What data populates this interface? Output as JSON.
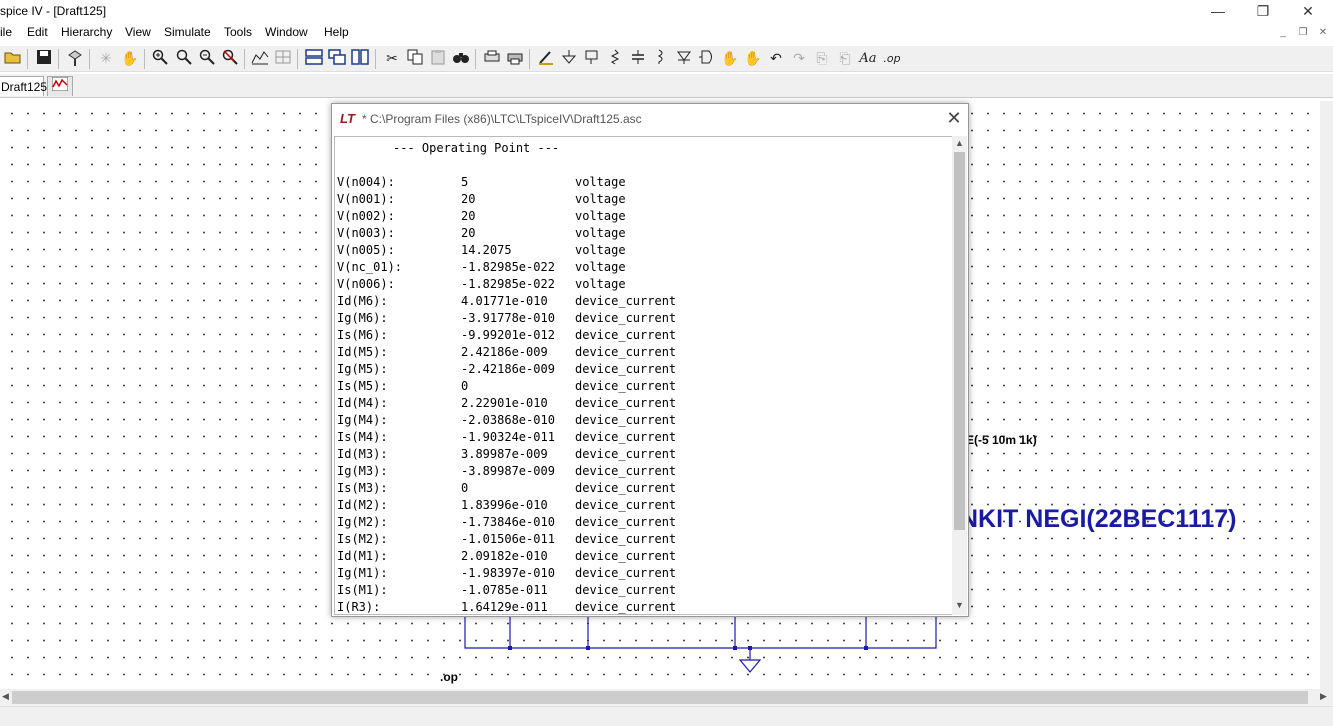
{
  "window": {
    "title": "spice IV - [Draft125]",
    "minimize": "—",
    "restore": "❐",
    "close": "✕"
  },
  "menu": {
    "items": [
      "ile",
      "Edit",
      "Hierarchy",
      "View",
      "Simulate",
      "Tools",
      "Window",
      "Help"
    ],
    "mdi_min": "_",
    "mdi_restore": "❐",
    "mdi_close": "✕"
  },
  "toolbar": {
    "icons": [
      "open-folder-icon",
      "save-icon",
      "control-panel-icon",
      "run-icon",
      "pan-hand-icon",
      "zoom-in-icon",
      "zoom-out-icon",
      "zoom-fit-icon",
      "zoom-cancel-icon",
      "autorange-icon",
      "grid-icon",
      "tile-horizontal-icon",
      "cascade-icon",
      "tile-vertical-icon",
      "cut-icon",
      "copy-icon",
      "paste-icon",
      "find-icon",
      "print-preview-icon",
      "print-icon",
      "wire-icon",
      "ground-icon",
      "label-net-icon",
      "resistor-icon",
      "capacitor-icon",
      "inductor-icon",
      "diode-icon",
      "component-icon",
      "move-icon",
      "drag-icon",
      "undo-icon",
      "redo-icon",
      "rotate-icon",
      "mirror-icon",
      "text-icon",
      "spice-directive-icon"
    ],
    "text_label": "Aa",
    "op_label": ".op"
  },
  "tabs": {
    "schematic": "Draft125"
  },
  "schematic": {
    "source_label": "E(-5 10m 1k)",
    "name_label": "NKIT NEGI(22BEC1117)",
    "directive": ".op"
  },
  "dialog": {
    "path": "* C:\\Program Files (x86)\\LTC\\LTspiceIV\\Draft125.asc",
    "logo": "LT",
    "header": "--- Operating Point ---",
    "rows": [
      {
        "name": "V(n004):",
        "value": "5",
        "type": "voltage"
      },
      {
        "name": "V(n001):",
        "value": "20",
        "type": "voltage"
      },
      {
        "name": "V(n002):",
        "value": "20",
        "type": "voltage"
      },
      {
        "name": "V(n003):",
        "value": "20",
        "type": "voltage"
      },
      {
        "name": "V(n005):",
        "value": "14.2075",
        "type": "voltage"
      },
      {
        "name": "V(nc_01):",
        "value": "-1.82985e-022",
        "type": "voltage"
      },
      {
        "name": "V(n006):",
        "value": "-1.82985e-022",
        "type": "voltage"
      },
      {
        "name": "Id(M6):",
        "value": "4.01771e-010",
        "type": "device_current"
      },
      {
        "name": "Ig(M6):",
        "value": "-3.91778e-010",
        "type": "device_current"
      },
      {
        "name": "Is(M6):",
        "value": "-9.99201e-012",
        "type": "device_current"
      },
      {
        "name": "Id(M5):",
        "value": "2.42186e-009",
        "type": "device_current"
      },
      {
        "name": "Ig(M5):",
        "value": "-2.42186e-009",
        "type": "device_current"
      },
      {
        "name": "Is(M5):",
        "value": "0",
        "type": "device_current"
      },
      {
        "name": "Id(M4):",
        "value": "2.22901e-010",
        "type": "device_current"
      },
      {
        "name": "Ig(M4):",
        "value": "-2.03868e-010",
        "type": "device_current"
      },
      {
        "name": "Is(M4):",
        "value": "-1.90324e-011",
        "type": "device_current"
      },
      {
        "name": "Id(M3):",
        "value": "3.89987e-009",
        "type": "device_current"
      },
      {
        "name": "Ig(M3):",
        "value": "-3.89987e-009",
        "type": "device_current"
      },
      {
        "name": "Is(M3):",
        "value": "0",
        "type": "device_current"
      },
      {
        "name": "Id(M2):",
        "value": "1.83996e-010",
        "type": "device_current"
      },
      {
        "name": "Ig(M2):",
        "value": "-1.73846e-010",
        "type": "device_current"
      },
      {
        "name": "Is(M2):",
        "value": "-1.01506e-011",
        "type": "device_current"
      },
      {
        "name": "Id(M1):",
        "value": "2.09182e-010",
        "type": "device_current"
      },
      {
        "name": "Ig(M1):",
        "value": "-1.98397e-010",
        "type": "device_current"
      },
      {
        "name": "Is(M1):",
        "value": "-1.0785e-011",
        "type": "device_current"
      },
      {
        "name": "I(R3):",
        "value": "1.64129e-011",
        "type": "device_current"
      }
    ],
    "close": "✕"
  }
}
